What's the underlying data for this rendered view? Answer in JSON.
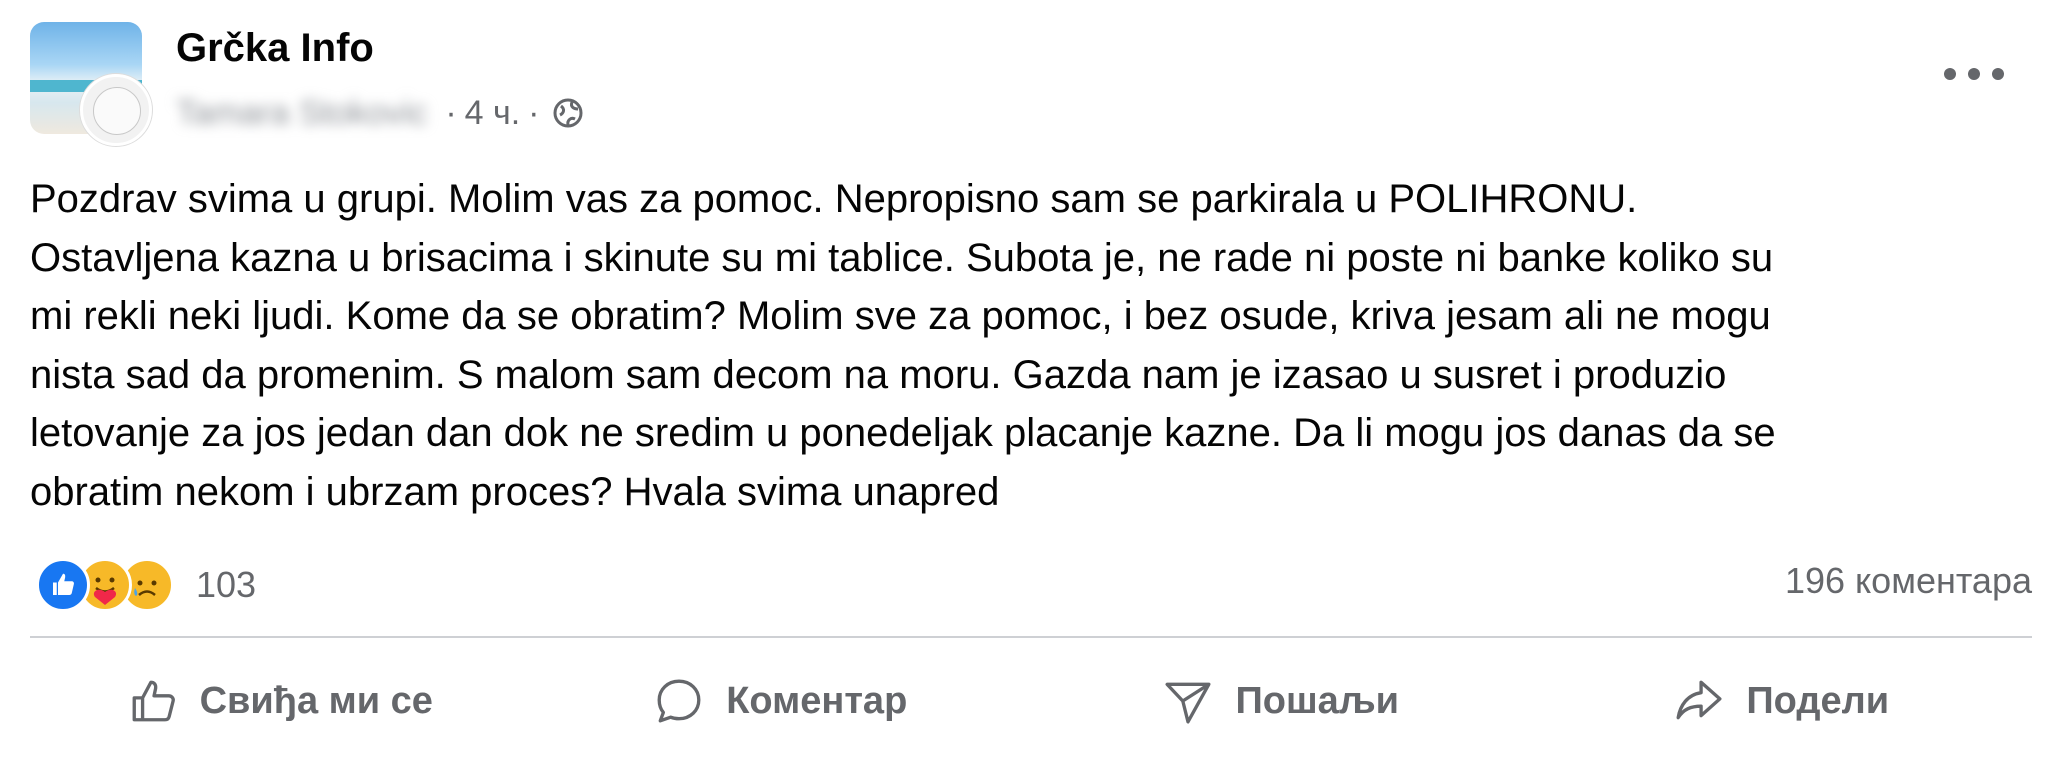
{
  "post": {
    "group_name": "Grčka Info",
    "author_name": "Tamara Stokovic",
    "time": "4 ч.",
    "separator": "·",
    "body_lines": [
      "Pozdrav svima u grupi. Molim vas za pomoc. Nepropisno sam se parkirala u POLIHRONU.",
      "Ostavljena kazna u brisacima i skinute su mi tablice. Subota je, ne rade ni poste ni banke koliko su",
      "mi rekli neki ljudi. Kome da se obratim? Molim sve za pomoc, i bez osude, kriva jesam ali ne mogu",
      "nista sad da promenim. S malom sam decom na moru. Gazda nam je izasao u susret i produzio",
      "letovanje za jos jedan dan dok ne sredim u ponedeljak placanje kazne. Da li mogu jos danas da se",
      "obratim nekom i ubrzam proces? Hvala svima unapred"
    ]
  },
  "reactions": {
    "icons": [
      "like-icon",
      "care-icon",
      "sad-icon"
    ],
    "count": "103",
    "comments": "196 коментара"
  },
  "actions": {
    "like": "Свиђа ми се",
    "comment": "Коментар",
    "send": "Пошаљи",
    "share": "Подели"
  },
  "colors": {
    "text": "#050505",
    "secondary": "#65676b",
    "like_blue": "#1877f2",
    "reaction_yellow": "#f7b928",
    "divider": "#ced0d4"
  }
}
